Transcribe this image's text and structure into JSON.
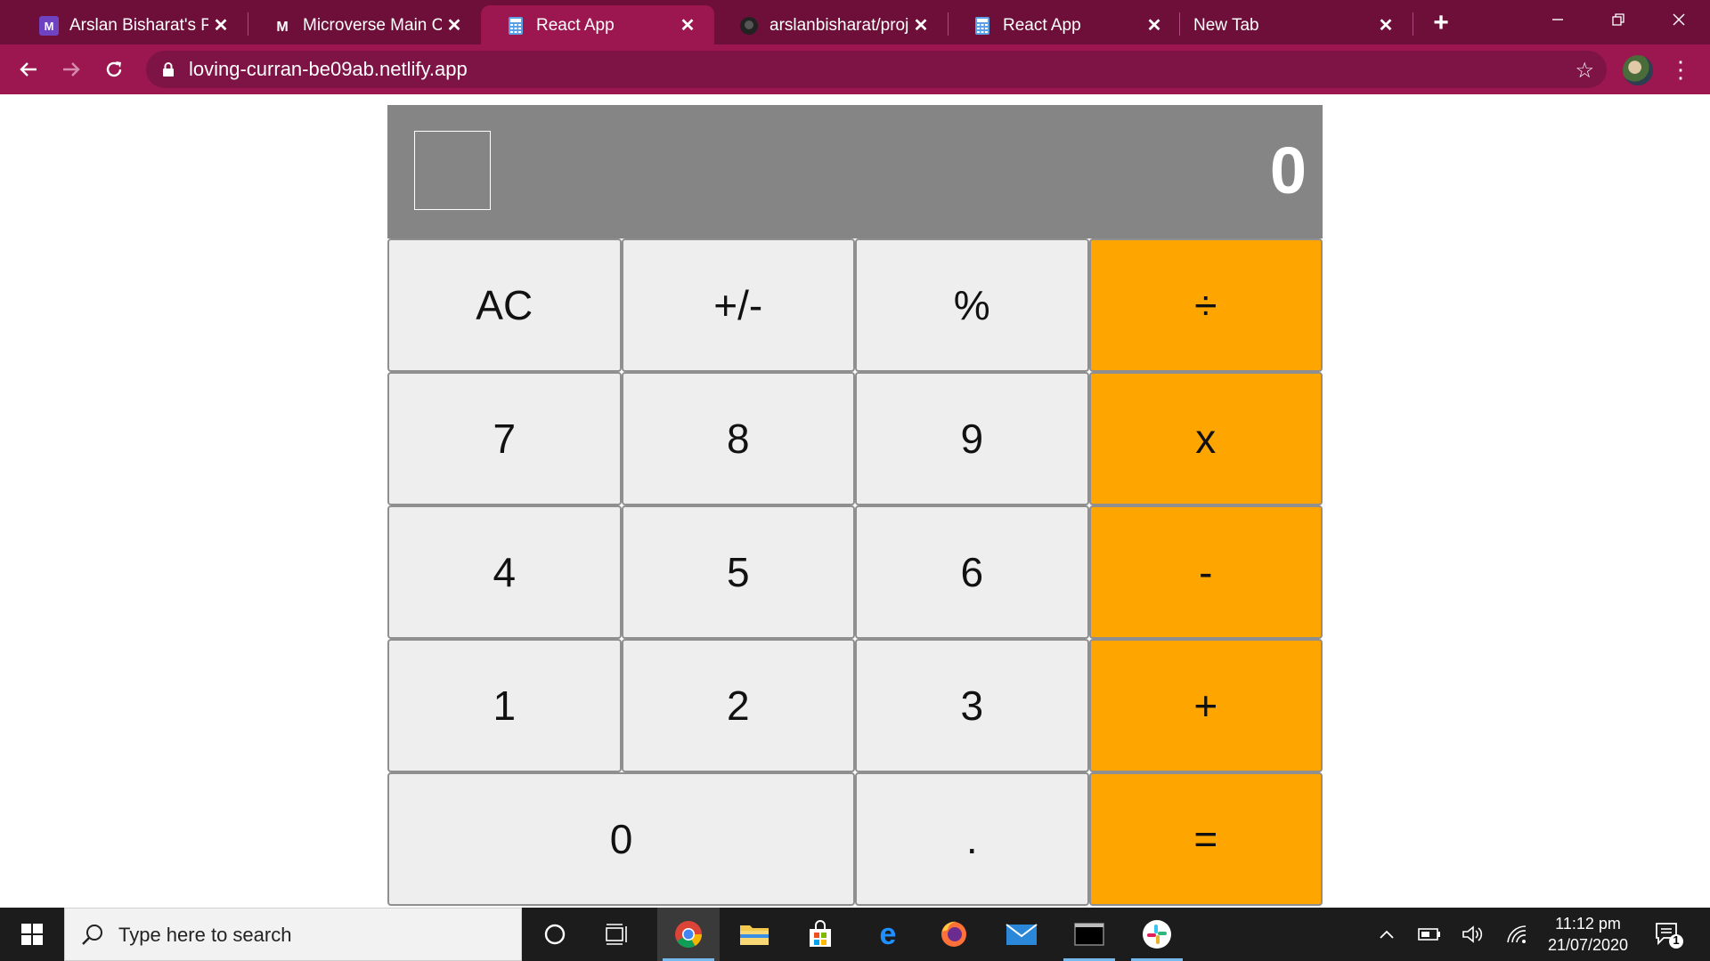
{
  "browser": {
    "tabs": [
      {
        "label": "Arslan Bisharat's Proj",
        "icon": "microverse-icon",
        "active": false
      },
      {
        "label": "Microverse Main Cur",
        "icon": "microverse-icon",
        "active": false
      },
      {
        "label": "React App",
        "icon": "calculator-icon",
        "active": true
      },
      {
        "label": "arslanbisharat/projec",
        "icon": "github-icon",
        "active": false
      },
      {
        "label": "React App",
        "icon": "calculator-icon",
        "active": false
      },
      {
        "label": "New Tab",
        "icon": "",
        "active": false
      }
    ],
    "url": "loving-curran-be09ab.netlify.app",
    "colors": {
      "tab_strip": "#6e0f3a",
      "active_tab": "#9c1750"
    }
  },
  "calculator": {
    "display_value": "0",
    "buttons": [
      [
        "AC",
        "+/-",
        "%",
        "÷"
      ],
      [
        "7",
        "8",
        "9",
        "x"
      ],
      [
        "4",
        "5",
        "6",
        "-"
      ],
      [
        "1",
        "2",
        "3",
        "+"
      ],
      [
        "0",
        ".",
        "="
      ]
    ],
    "colors": {
      "display_bg": "#858585",
      "key_bg": "#eeeeee",
      "operator_bg": "#ffa500"
    }
  },
  "taskbar": {
    "search_placeholder": "Type here to search",
    "time": "11:12 pm",
    "date": "21/07/2020",
    "notification_count": "1"
  }
}
